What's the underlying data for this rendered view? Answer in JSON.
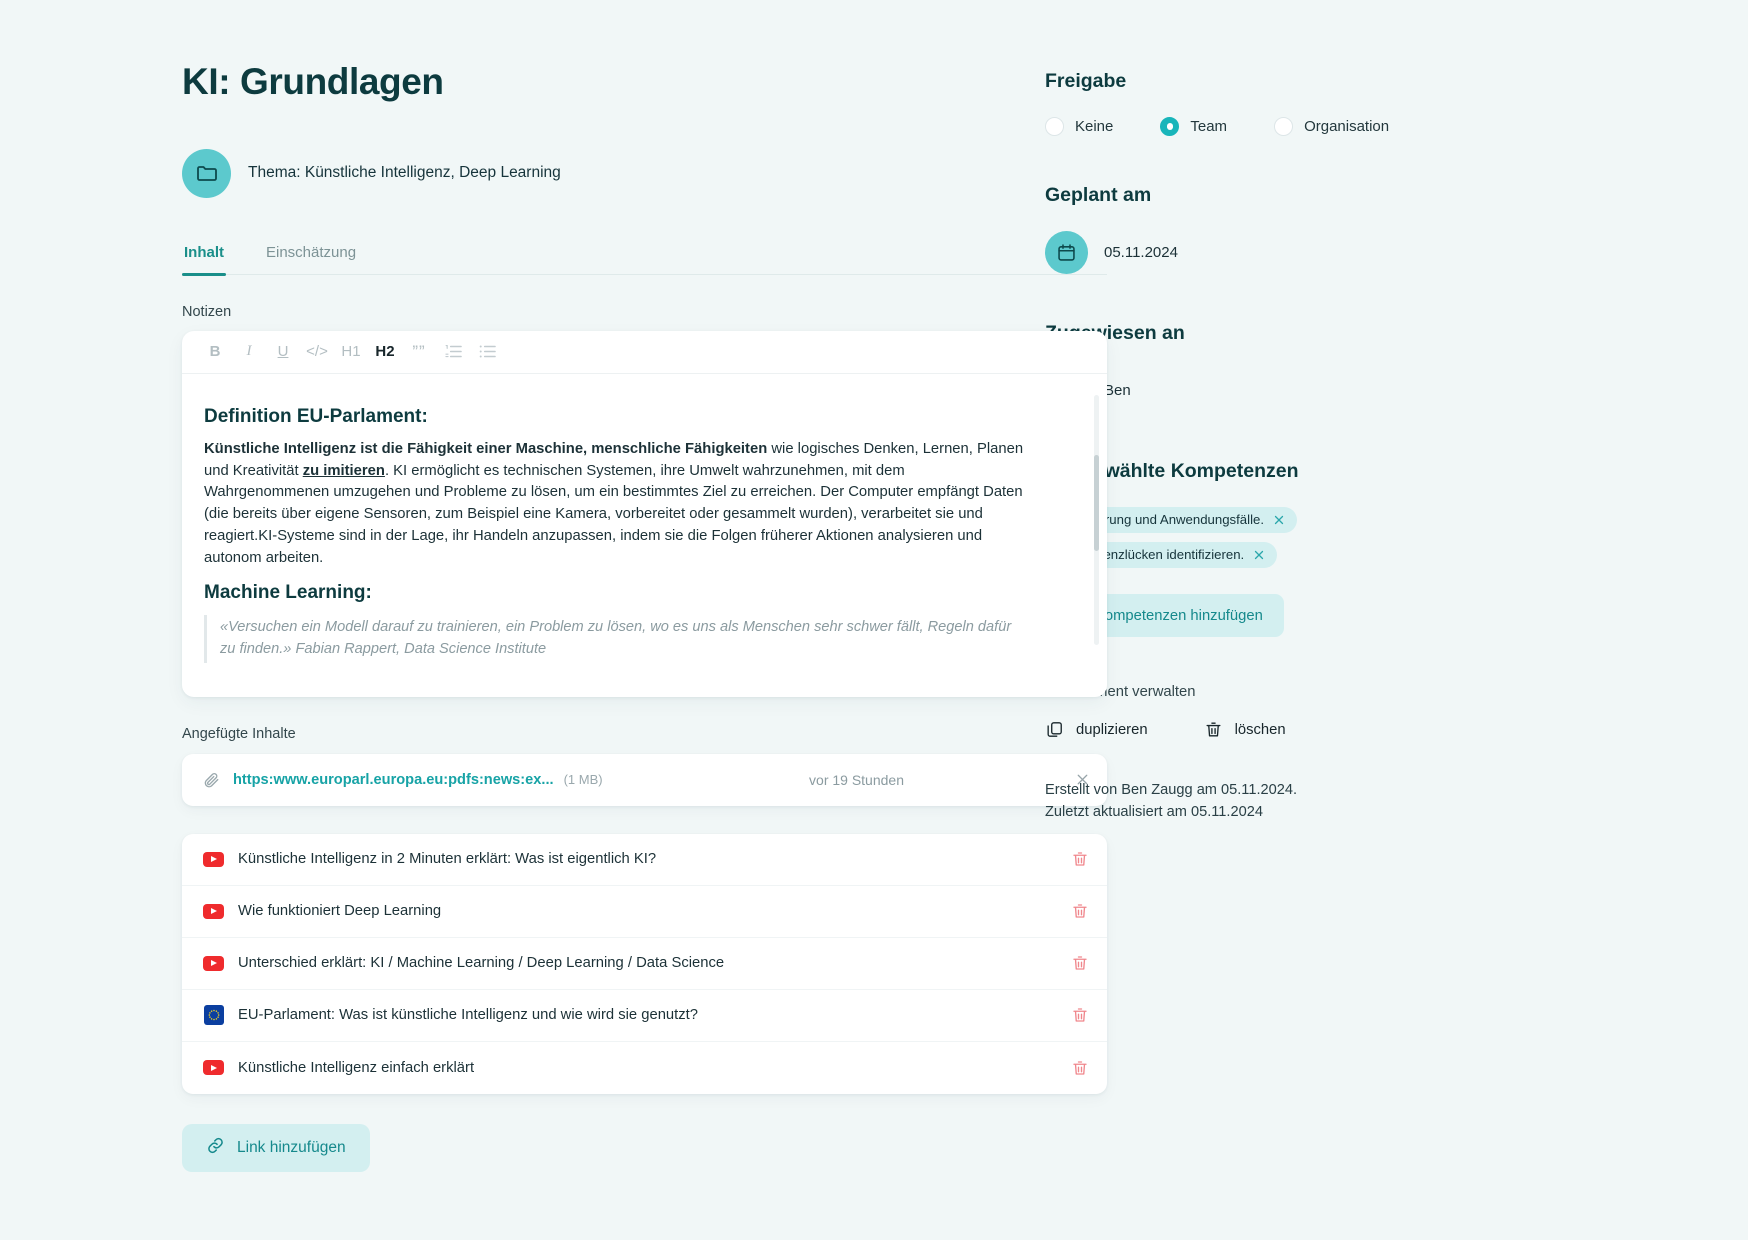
{
  "header": {
    "title": "KI: Grundlagen",
    "topic": "Thema: Künstliche Intelligenz, Deep Learning",
    "topic_icon": "folder-icon"
  },
  "tabs": [
    {
      "label": "Inhalt",
      "active": true
    },
    {
      "label": "Einschätzung",
      "active": false
    }
  ],
  "notes": {
    "label": "Notizen",
    "toolbar": [
      {
        "name": "bold",
        "label": "B"
      },
      {
        "name": "italic",
        "label": "I"
      },
      {
        "name": "underline",
        "label": "U"
      },
      {
        "name": "code",
        "label": "</>"
      },
      {
        "name": "heading-1",
        "label": "H1"
      },
      {
        "name": "heading-2",
        "label": "H2"
      },
      {
        "name": "quote",
        "label": "””"
      },
      {
        "name": "ordered-list",
        "label": ""
      },
      {
        "name": "bullet-list",
        "label": ""
      }
    ],
    "content": {
      "heading_1": "Definition EU-Parlament:",
      "paragraph_bold_lead": "Künstliche Intelligenz ist die Fähigkeit einer Maschine, menschliche Fähigkeiten",
      "paragraph_rest_a": " wie logisches Denken, Lernen, Planen und Kreativität ",
      "paragraph_underlined": "zu imitieren",
      "paragraph_rest_b": ". KI ermöglicht es technischen Systemen, ihre Umwelt wahrzunehmen, mit dem Wahrgenommenen umzugehen und Probleme zu lösen, um ein bestimmtes Ziel zu erreichen. Der Computer empfängt Daten (die bereits über eigene Sensoren, zum Beispiel eine Kamera, vorbereitet oder gesammelt wurden), verarbeitet sie und reagiert.KI-Systeme sind in der Lage, ihr Handeln anzupassen, indem sie die Folgen früherer Aktionen analysieren und autonom arbeiten.",
      "heading_2": "Machine Learning:",
      "quote": "«Versuchen ein Modell darauf zu trainieren, ein Problem zu lösen, wo es uns als Menschen sehr schwer fällt, Regeln dafür zu finden.» Fabian Rappert, Data Science Institute"
    }
  },
  "attachments": {
    "label": "Angefügte Inhalte",
    "item": {
      "icon": "paperclip-icon",
      "url": "https:www.europarl.europa.eu:pdfs:news:ex...",
      "size": "(1 MB)",
      "time": "vor 19 Stunden",
      "remove_icon": "close-icon"
    }
  },
  "links": [
    {
      "icon": "youtube-icon",
      "title": "Künstliche Intelligenz in 2 Minuten erklärt: Was ist eigentlich KI?"
    },
    {
      "icon": "youtube-icon",
      "title": "Wie funktioniert Deep Learning"
    },
    {
      "icon": "youtube-icon",
      "title": "Unterschied erklärt: KI / Machine Learning / Deep Learning / Data Science"
    },
    {
      "icon": "eu-flag-icon",
      "title": "EU-Parlament: Was ist künstliche Intelligenz und wie wird sie genutzt?"
    },
    {
      "icon": "youtube-icon",
      "title": "Künstliche Intelligenz einfach erklärt"
    }
  ],
  "add_link_button": {
    "label": "Link hinzufügen",
    "icon": "link-icon"
  },
  "sidebar": {
    "freigabe": {
      "heading": "Freigabe",
      "options": [
        {
          "label": "Keine",
          "selected": false
        },
        {
          "label": "Team",
          "selected": true
        },
        {
          "label": "Organisation",
          "selected": false
        }
      ]
    },
    "geplant": {
      "heading": "Geplant am",
      "icon": "calendar-icon",
      "value": "05.11.2024"
    },
    "zugewiesen": {
      "heading": "Zugewiesen an",
      "icon": "user-icon",
      "value": "Ben"
    },
    "kompetenzen": {
      "heading": "Ausgewählte Kompetenzen",
      "chips": [
        "KI-Erklärung und Anwendungsfälle.",
        "Kompetenzlücken identifizieren."
      ],
      "add_button": {
        "label": "Kompetenzen hinzufügen",
        "icon": "puzzle-icon"
      }
    },
    "manage": {
      "label": "Lernmoment verwalten",
      "actions": [
        {
          "label": "duplizieren",
          "icon": "copy-icon"
        },
        {
          "label": "löschen",
          "icon": "trash-icon"
        }
      ]
    },
    "meta_line_1": "Erstellt von Ben Zaugg am 05.11.2024.",
    "meta_line_2": "Zuletzt aktualisiert am 05.11.2024"
  },
  "colors": {
    "background": "#f1f7f7",
    "accent_teal": "#19b5ba",
    "accent_dark": "#0d3b3f",
    "chip_bg": "#d3eff0",
    "danger": "#f0868c"
  }
}
